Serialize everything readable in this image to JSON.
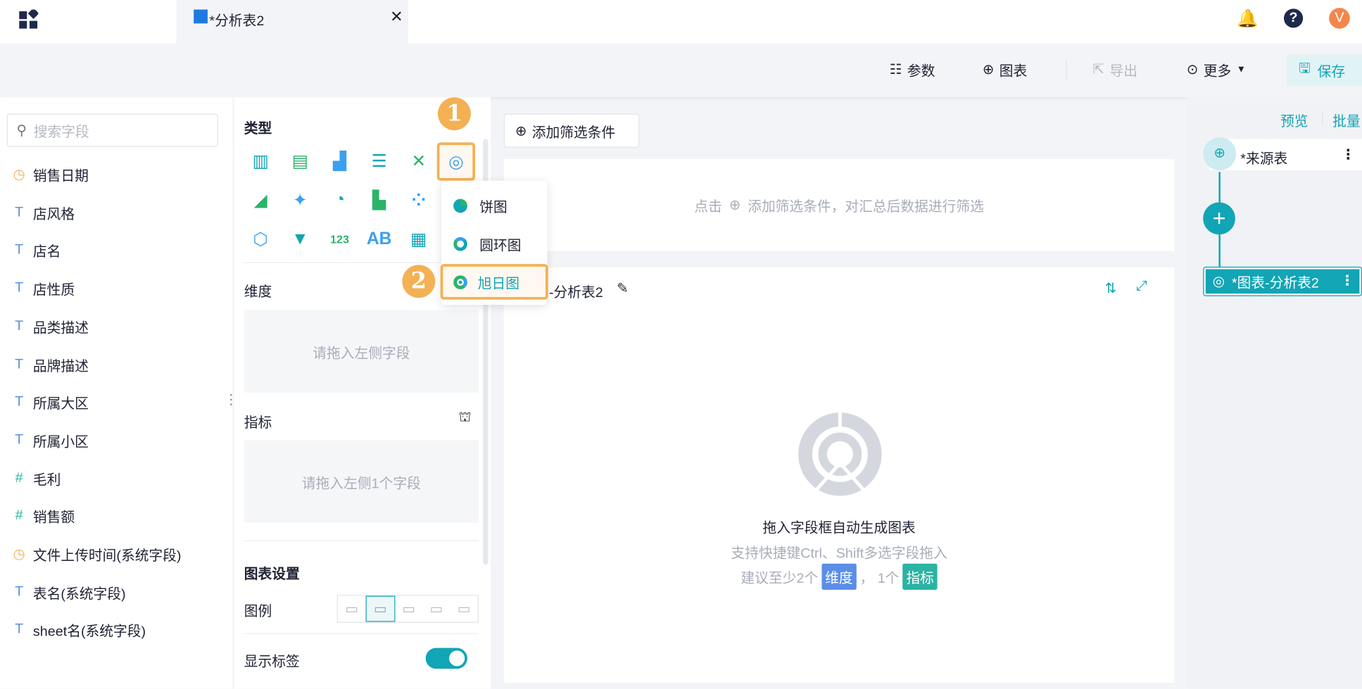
{
  "header": {
    "tab_title": "*分析表2",
    "avatar_letter": "V"
  },
  "toolbar": {
    "params": "参数",
    "chart": "图表",
    "export": "导出",
    "more": "更多",
    "save": "保存"
  },
  "fields": {
    "search_placeholder": "搜索字段",
    "items": [
      {
        "label": "销售日期",
        "type": "date"
      },
      {
        "label": "店风格",
        "type": "text"
      },
      {
        "label": "店名",
        "type": "text"
      },
      {
        "label": "店性质",
        "type": "text"
      },
      {
        "label": "品类描述",
        "type": "text"
      },
      {
        "label": "品牌描述",
        "type": "text"
      },
      {
        "label": "所属大区",
        "type": "text"
      },
      {
        "label": "所属小区",
        "type": "text"
      },
      {
        "label": "毛利",
        "type": "number"
      },
      {
        "label": "销售额",
        "type": "number"
      },
      {
        "label": "文件上传时间(系统字段)",
        "type": "date"
      },
      {
        "label": "表名(系统字段)",
        "type": "text"
      },
      {
        "label": "sheet名(系统字段)",
        "type": "text"
      }
    ]
  },
  "config": {
    "type_title": "类型",
    "dimension": "维度",
    "dimension_drop": "请拖入左侧字段",
    "measure": "指标",
    "measure_drop": "请拖入左侧1个字段",
    "chart_settings": "图表设置",
    "legend": "图例",
    "show_labels": "显示标签",
    "show_labels_on": true
  },
  "chart_type_menu": {
    "items": [
      "饼图",
      "圆环图",
      "旭日图"
    ],
    "selected": "旭日图"
  },
  "steps": {
    "one": "1",
    "two": "2"
  },
  "filter": {
    "add_label": "添加筛选条件",
    "hint_prefix": "点击",
    "hint_suffix": "添加筛选条件，对汇总后数据进行筛选"
  },
  "chart_card": {
    "title": "-分析表2",
    "empty_title": "拖入字段框自动生成图表",
    "empty_sub": "支持快捷键Ctrl、Shift多选字段拖入",
    "suggest_prefix": "建议至少2个",
    "tag_dim": "维度",
    "suggest_mid": "，  1个",
    "tag_measure": "指标"
  },
  "flow": {
    "preview": "预览",
    "batch": "批量",
    "source": "*来源表",
    "chart_node": "*图表-分析表2"
  },
  "colors": {
    "accent": "#12a5b5",
    "highlight": "#f3b154",
    "dim_tag": "#5b8ee6",
    "measure_tag": "#2bb3a3"
  }
}
